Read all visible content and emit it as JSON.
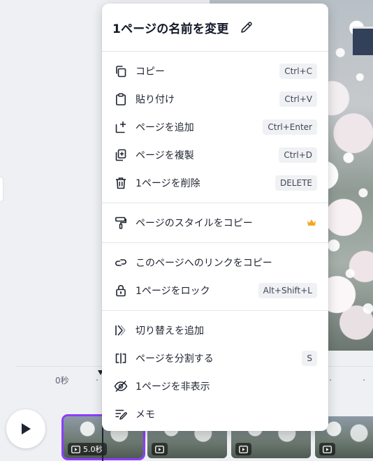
{
  "menu": {
    "title": "1ページの名前を変更",
    "sections": [
      {
        "items": [
          {
            "label": "コピー",
            "shortcut": "Ctrl+C",
            "icon": "copy-icon"
          },
          {
            "label": "貼り付け",
            "shortcut": "Ctrl+V",
            "icon": "clipboard-icon"
          },
          {
            "label": "ページを追加",
            "shortcut": "Ctrl+Enter",
            "icon": "add-page-icon"
          },
          {
            "label": "ページを複製",
            "shortcut": "Ctrl+D",
            "icon": "duplicate-icon"
          },
          {
            "label": "1ページを削除",
            "shortcut": "DELETE",
            "icon": "trash-icon"
          }
        ]
      },
      {
        "items": [
          {
            "label": "ページのスタイルをコピー",
            "icon": "paint-roller-icon",
            "badge": "crown-icon"
          }
        ]
      },
      {
        "items": [
          {
            "label": "このページへのリンクをコピー",
            "icon": "link-icon"
          },
          {
            "label": "1ページをロック",
            "shortcut": "Alt+Shift+L",
            "icon": "lock-icon"
          }
        ]
      },
      {
        "items": [
          {
            "label": "切り替えを追加",
            "icon": "transition-icon"
          },
          {
            "label": "ページを分割する",
            "shortcut": "S",
            "icon": "split-icon"
          },
          {
            "label": "1ページを非表示",
            "icon": "eye-off-icon"
          },
          {
            "label": "メモ",
            "icon": "notes-icon"
          }
        ]
      }
    ]
  },
  "timeline": {
    "time_label": "0秒",
    "clips": [
      {
        "duration": "5.0秒",
        "selected": true
      },
      {
        "duration": ""
      },
      {
        "duration": ""
      },
      {
        "duration": ""
      }
    ]
  },
  "colors": {
    "accent": "#8b3dff",
    "crown": "#f5a623"
  }
}
